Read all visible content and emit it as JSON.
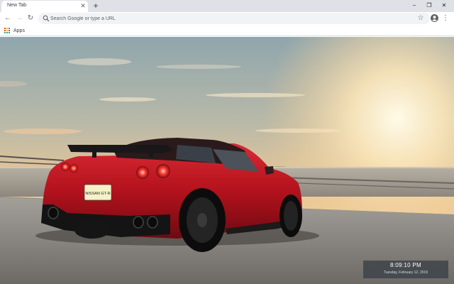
{
  "browser": {
    "tab": {
      "title": "New Tab",
      "close_icon": "close-icon"
    },
    "new_tab_icon": "plus-icon",
    "window_controls": {
      "minimize": "–",
      "restore": "❐",
      "close": "✕"
    }
  },
  "toolbar": {
    "back": "←",
    "forward": "→",
    "reload": "↻",
    "omnibox": {
      "placeholder": "Search Google or type a URL",
      "value": ""
    },
    "bookmark_star": "☆",
    "menu": "⋮"
  },
  "bookmarks_bar": {
    "apps_label": "Apps"
  },
  "wallpaper": {
    "subject": "red sports car on rooftop at sunset",
    "plate_text": "NISSAN GT-R"
  },
  "clock_widget": {
    "time": "8:09:10 PM",
    "date": "Tuesday, February 12, 2019"
  },
  "colors": {
    "tabstrip": "#dee1e6",
    "omnibox": "#f1f3f4",
    "car_red": "#b3121c",
    "sky_warm": "#f3c58a"
  }
}
